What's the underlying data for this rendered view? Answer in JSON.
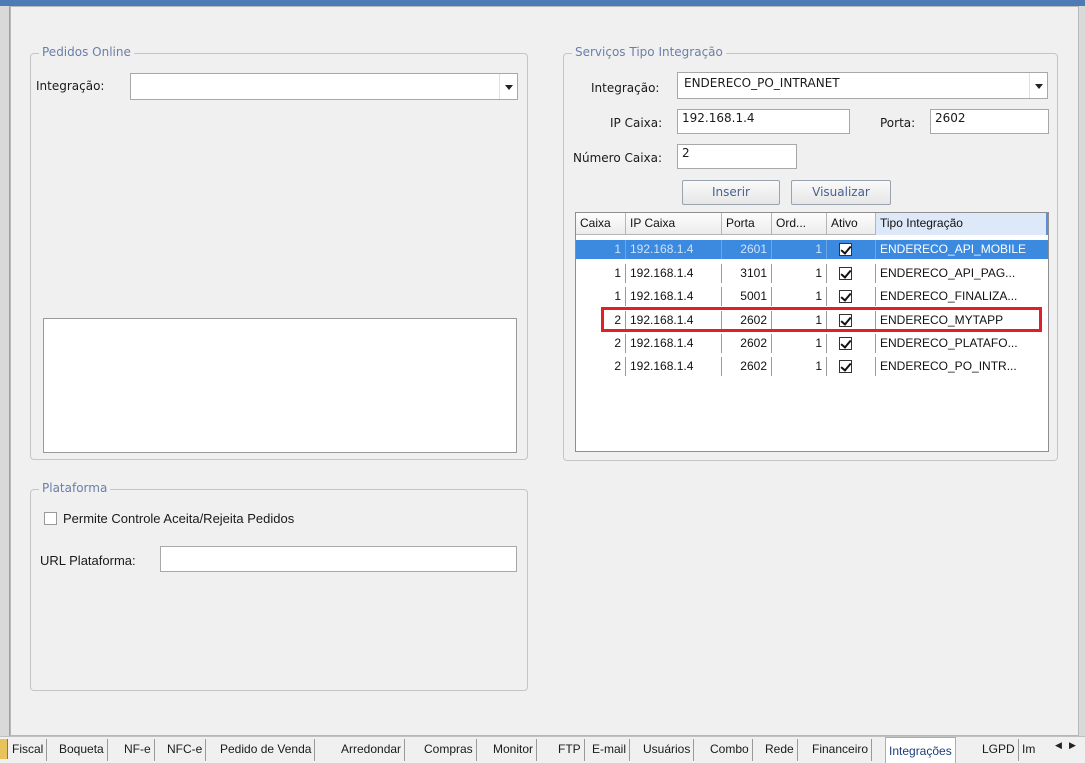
{
  "pedidos_online": {
    "legend": "Pedidos Online",
    "integracao_label": "Integração:",
    "integracao_value": ""
  },
  "servicos": {
    "legend": "Serviços Tipo Integração",
    "integracao_label": "Integração:",
    "integracao_value": "ENDERECO_PO_INTRANET",
    "ip_label": "IP Caixa:",
    "ip_value": "192.168.1.4",
    "porta_label": "Porta:",
    "porta_value": "2602",
    "numero_label": "Número Caixa:",
    "numero_value": "2",
    "inserir_label": "Inserir",
    "visualizar_label": "Visualizar",
    "columns": [
      "Caixa",
      "IP Caixa",
      "Porta",
      "Ord...",
      "Ativo",
      "Tipo Integração"
    ],
    "rows": [
      {
        "caixa": "1",
        "ip": "192.168.1.4",
        "porta": "2601",
        "ord": "1",
        "ativo": true,
        "tipo": "ENDERECO_API_MOBILE"
      },
      {
        "caixa": "1",
        "ip": "192.168.1.4",
        "porta": "3101",
        "ord": "1",
        "ativo": true,
        "tipo": "ENDERECO_API_PAG..."
      },
      {
        "caixa": "1",
        "ip": "192.168.1.4",
        "porta": "5001",
        "ord": "1",
        "ativo": true,
        "tipo": "ENDERECO_FINALIZA..."
      },
      {
        "caixa": "2",
        "ip": "192.168.1.4",
        "porta": "2602",
        "ord": "1",
        "ativo": true,
        "tipo": "ENDERECO_MYTAPP"
      },
      {
        "caixa": "2",
        "ip": "192.168.1.4",
        "porta": "2602",
        "ord": "1",
        "ativo": true,
        "tipo": "ENDERECO_PLATAFO..."
      },
      {
        "caixa": "2",
        "ip": "192.168.1.4",
        "porta": "2602",
        "ord": "1",
        "ativo": true,
        "tipo": "ENDERECO_PO_INTR..."
      }
    ],
    "selected_row": 0,
    "highlighted_row": 3,
    "highlight_color": "#e01f2a",
    "selection_color": "#3b8ae0"
  },
  "plataforma": {
    "legend": "Plataforma",
    "permite_label": "Permite Controle Aceita/Rejeita Pedidos",
    "permite_checked": false,
    "url_label": "URL Plataforma:",
    "url_value": ""
  },
  "tabs": {
    "items": [
      "Fiscal",
      "Boqueta",
      "NF-e",
      "NFC-e",
      "Pedido de Venda",
      "Arredondar",
      "Compras",
      "Monitor",
      "FTP",
      "E-mail",
      "Usuários",
      "Combo",
      "Rede",
      "Financeiro",
      "Integrações",
      "LGPD",
      "Im"
    ],
    "active": "Integrações"
  }
}
